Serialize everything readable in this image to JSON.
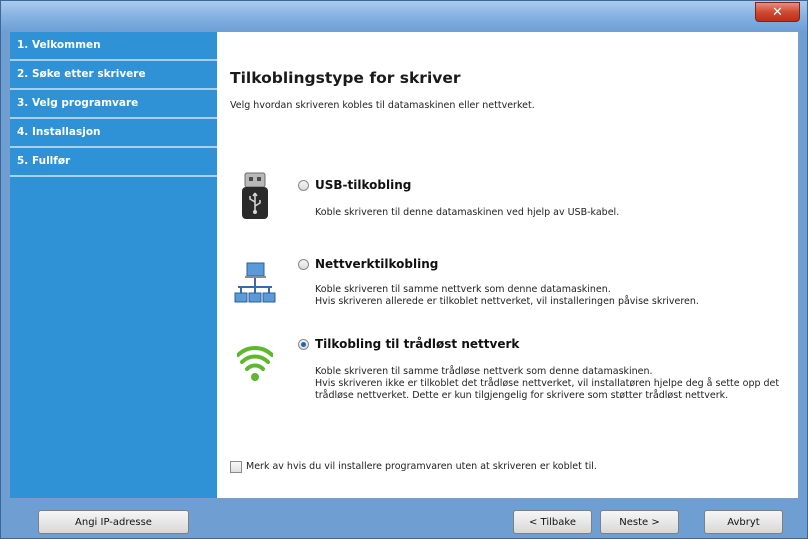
{
  "window": {
    "close_glyph": "✕"
  },
  "sidebar": {
    "steps": [
      {
        "label": "1. Velkommen"
      },
      {
        "label": "2. Søke etter skrivere"
      },
      {
        "label": "3. Velg programvare"
      },
      {
        "label": "4. Installasjon"
      },
      {
        "label": "5. Fullfør"
      }
    ]
  },
  "main": {
    "title": "Tilkoblingstype for skriver",
    "subtitle": "Velg hvordan skriveren kobles til datamaskinen eller nettverket.",
    "options": [
      {
        "label": "USB-tilkobling",
        "icon": "usb-icon",
        "selected": false,
        "description": [
          "Koble skriveren til denne datamaskinen ved hjelp av USB-kabel."
        ]
      },
      {
        "label": "Nettverktilkobling",
        "icon": "network-icon",
        "selected": false,
        "description": [
          "Koble skriveren til samme nettverk som denne datamaskinen.",
          "Hvis skriveren allerede er tilkoblet nettverket, vil installeringen påvise skriveren."
        ]
      },
      {
        "label": "Tilkobling til trådløst nettverk",
        "icon": "wifi-icon",
        "selected": true,
        "description": [
          "Koble skriveren til samme trådløse nettverk som denne datamaskinen.",
          "Hvis skriveren ikke er tilkoblet det trådløse nettverket, vil installatøren hjelpe deg å sette opp det",
          "trådløse nettverket. Dette er kun tilgjengelig for skrivere som støtter trådløst nettverk."
        ]
      }
    ],
    "install_without_printer": {
      "label": "Merk av hvis du vil installere programvaren uten at skriveren er koblet til.",
      "checked": false
    }
  },
  "footer": {
    "ip_button": "Angi IP-adresse",
    "back_button": "< Tilbake",
    "next_button": "Neste >",
    "cancel_button": "Avbryt"
  },
  "colors": {
    "sidebar": "#2f91d6",
    "titlebar": "#86b2e2",
    "accent_wifi": "#5db82e",
    "close": "#cf4a31"
  }
}
